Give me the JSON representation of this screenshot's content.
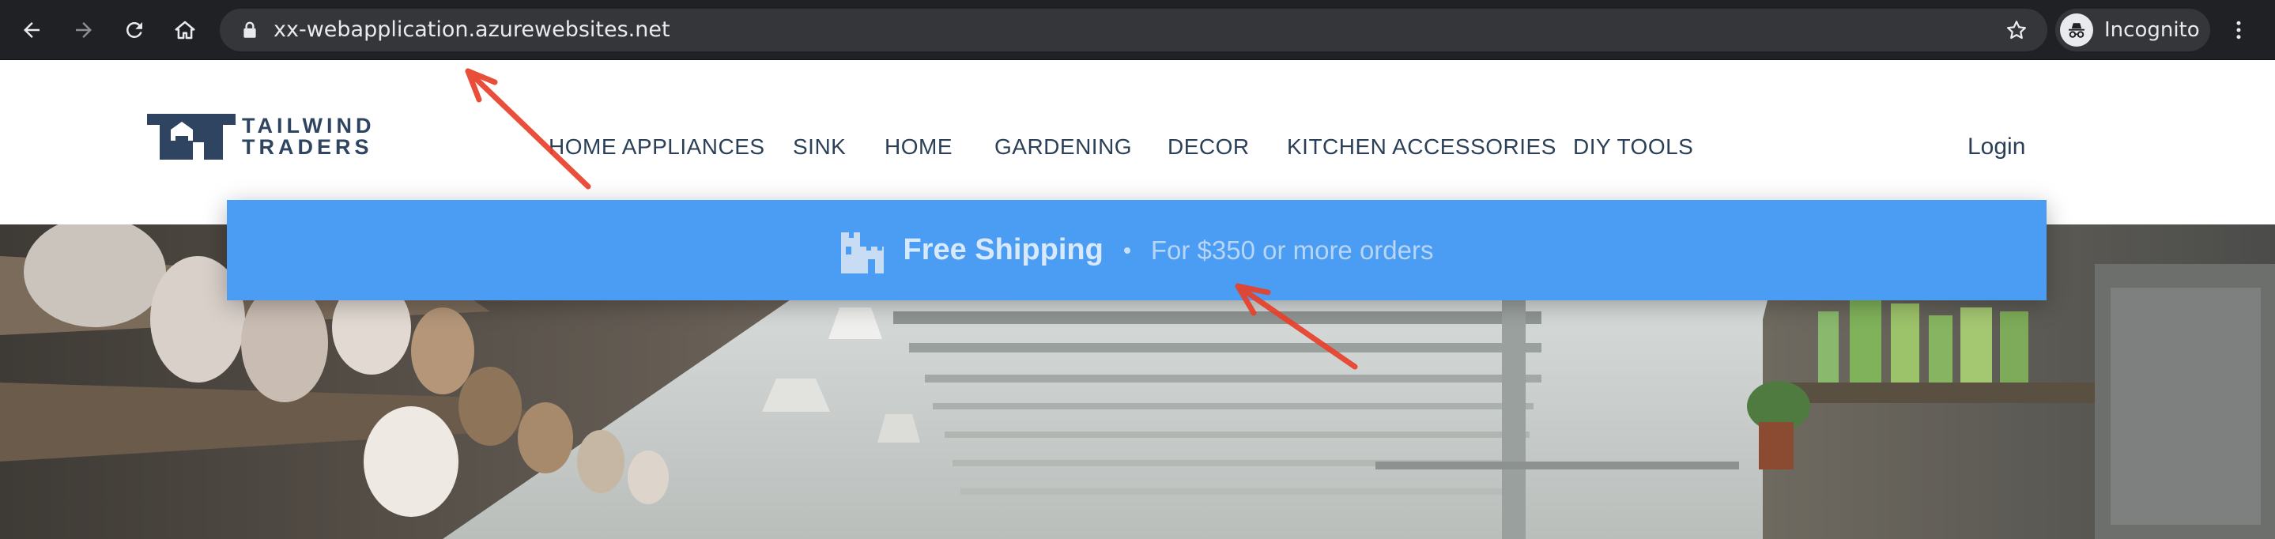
{
  "browser": {
    "url": "xx-webapplication.azurewebsites.net",
    "profile_label": "Incognito",
    "icons": {
      "back": "back-arrow-icon",
      "forward": "forward-arrow-icon",
      "reload": "reload-icon",
      "home": "home-icon",
      "lock": "lock-icon",
      "bookmark": "star-icon",
      "incognito": "incognito-icon",
      "menu": "kebab-menu-icon"
    }
  },
  "site": {
    "logo": {
      "line1": "TAILWIND",
      "line2": "TRADERS"
    },
    "nav": [
      {
        "label": "HOME APPLIANCES"
      },
      {
        "label": "SINK"
      },
      {
        "label": "HOME"
      },
      {
        "label": "GARDENING"
      },
      {
        "label": "DECOR"
      },
      {
        "label": "KITCHEN ACCESSORIES"
      },
      {
        "label": "DIY TOOLS"
      }
    ],
    "login_label": "Login"
  },
  "banner": {
    "title": "Free Shipping",
    "detail": "For $350 or more orders",
    "icon": "castle-icon"
  },
  "colors": {
    "browser_chrome": "#202124",
    "address_bar": "#35363a",
    "brand_navy": "#2f4460",
    "banner_blue": "#4a9df3",
    "annotation_red": "#e8402a"
  }
}
